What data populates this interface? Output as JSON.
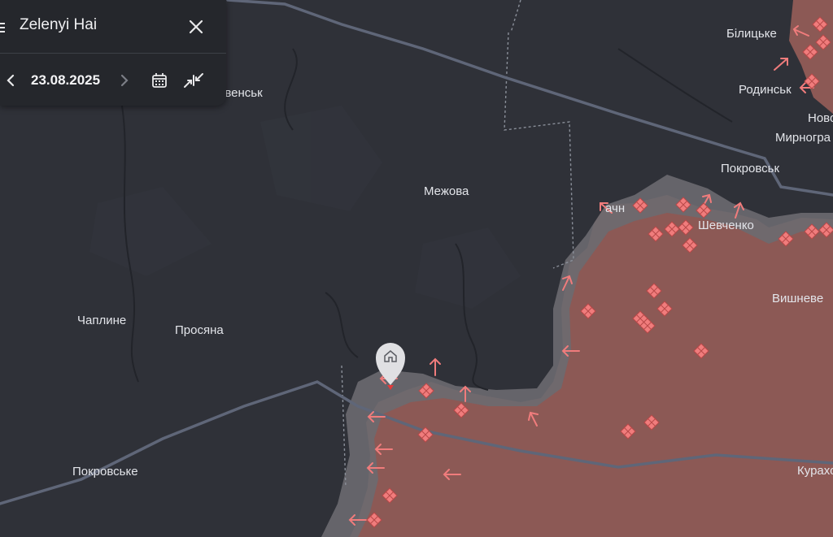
{
  "panel": {
    "title": "Zelenyi Hai",
    "date": "23.08.2025"
  },
  "icons": [
    "menu-icon",
    "close-icon",
    "chevron-left-icon",
    "chevron-right-icon",
    "calendar-icon",
    "compare-icon",
    "home-pin-icon"
  ],
  "colors": {
    "background": "#2f3138",
    "occupied": "#8c5955",
    "contested": "#6b6a70",
    "marker": "#f07c7c",
    "roads": "#5f6678"
  },
  "places": {
    "mezhova": "Межова",
    "chapline": "Чаплине",
    "prosiana": "Просяна",
    "pokrovske": "Покровське",
    "bilytske": "Білицьке",
    "rodynske": "Родинськ",
    "novo": "Ново",
    "myrnohrad": "Мирногра",
    "pokrovsk": "Покровськ",
    "shevchenko": "Шевченко",
    "vyshneve": "Вишневе",
    "kurakhove": "Курахо",
    "slavensk": "авенськ",
    "rachyn": "ачн"
  }
}
